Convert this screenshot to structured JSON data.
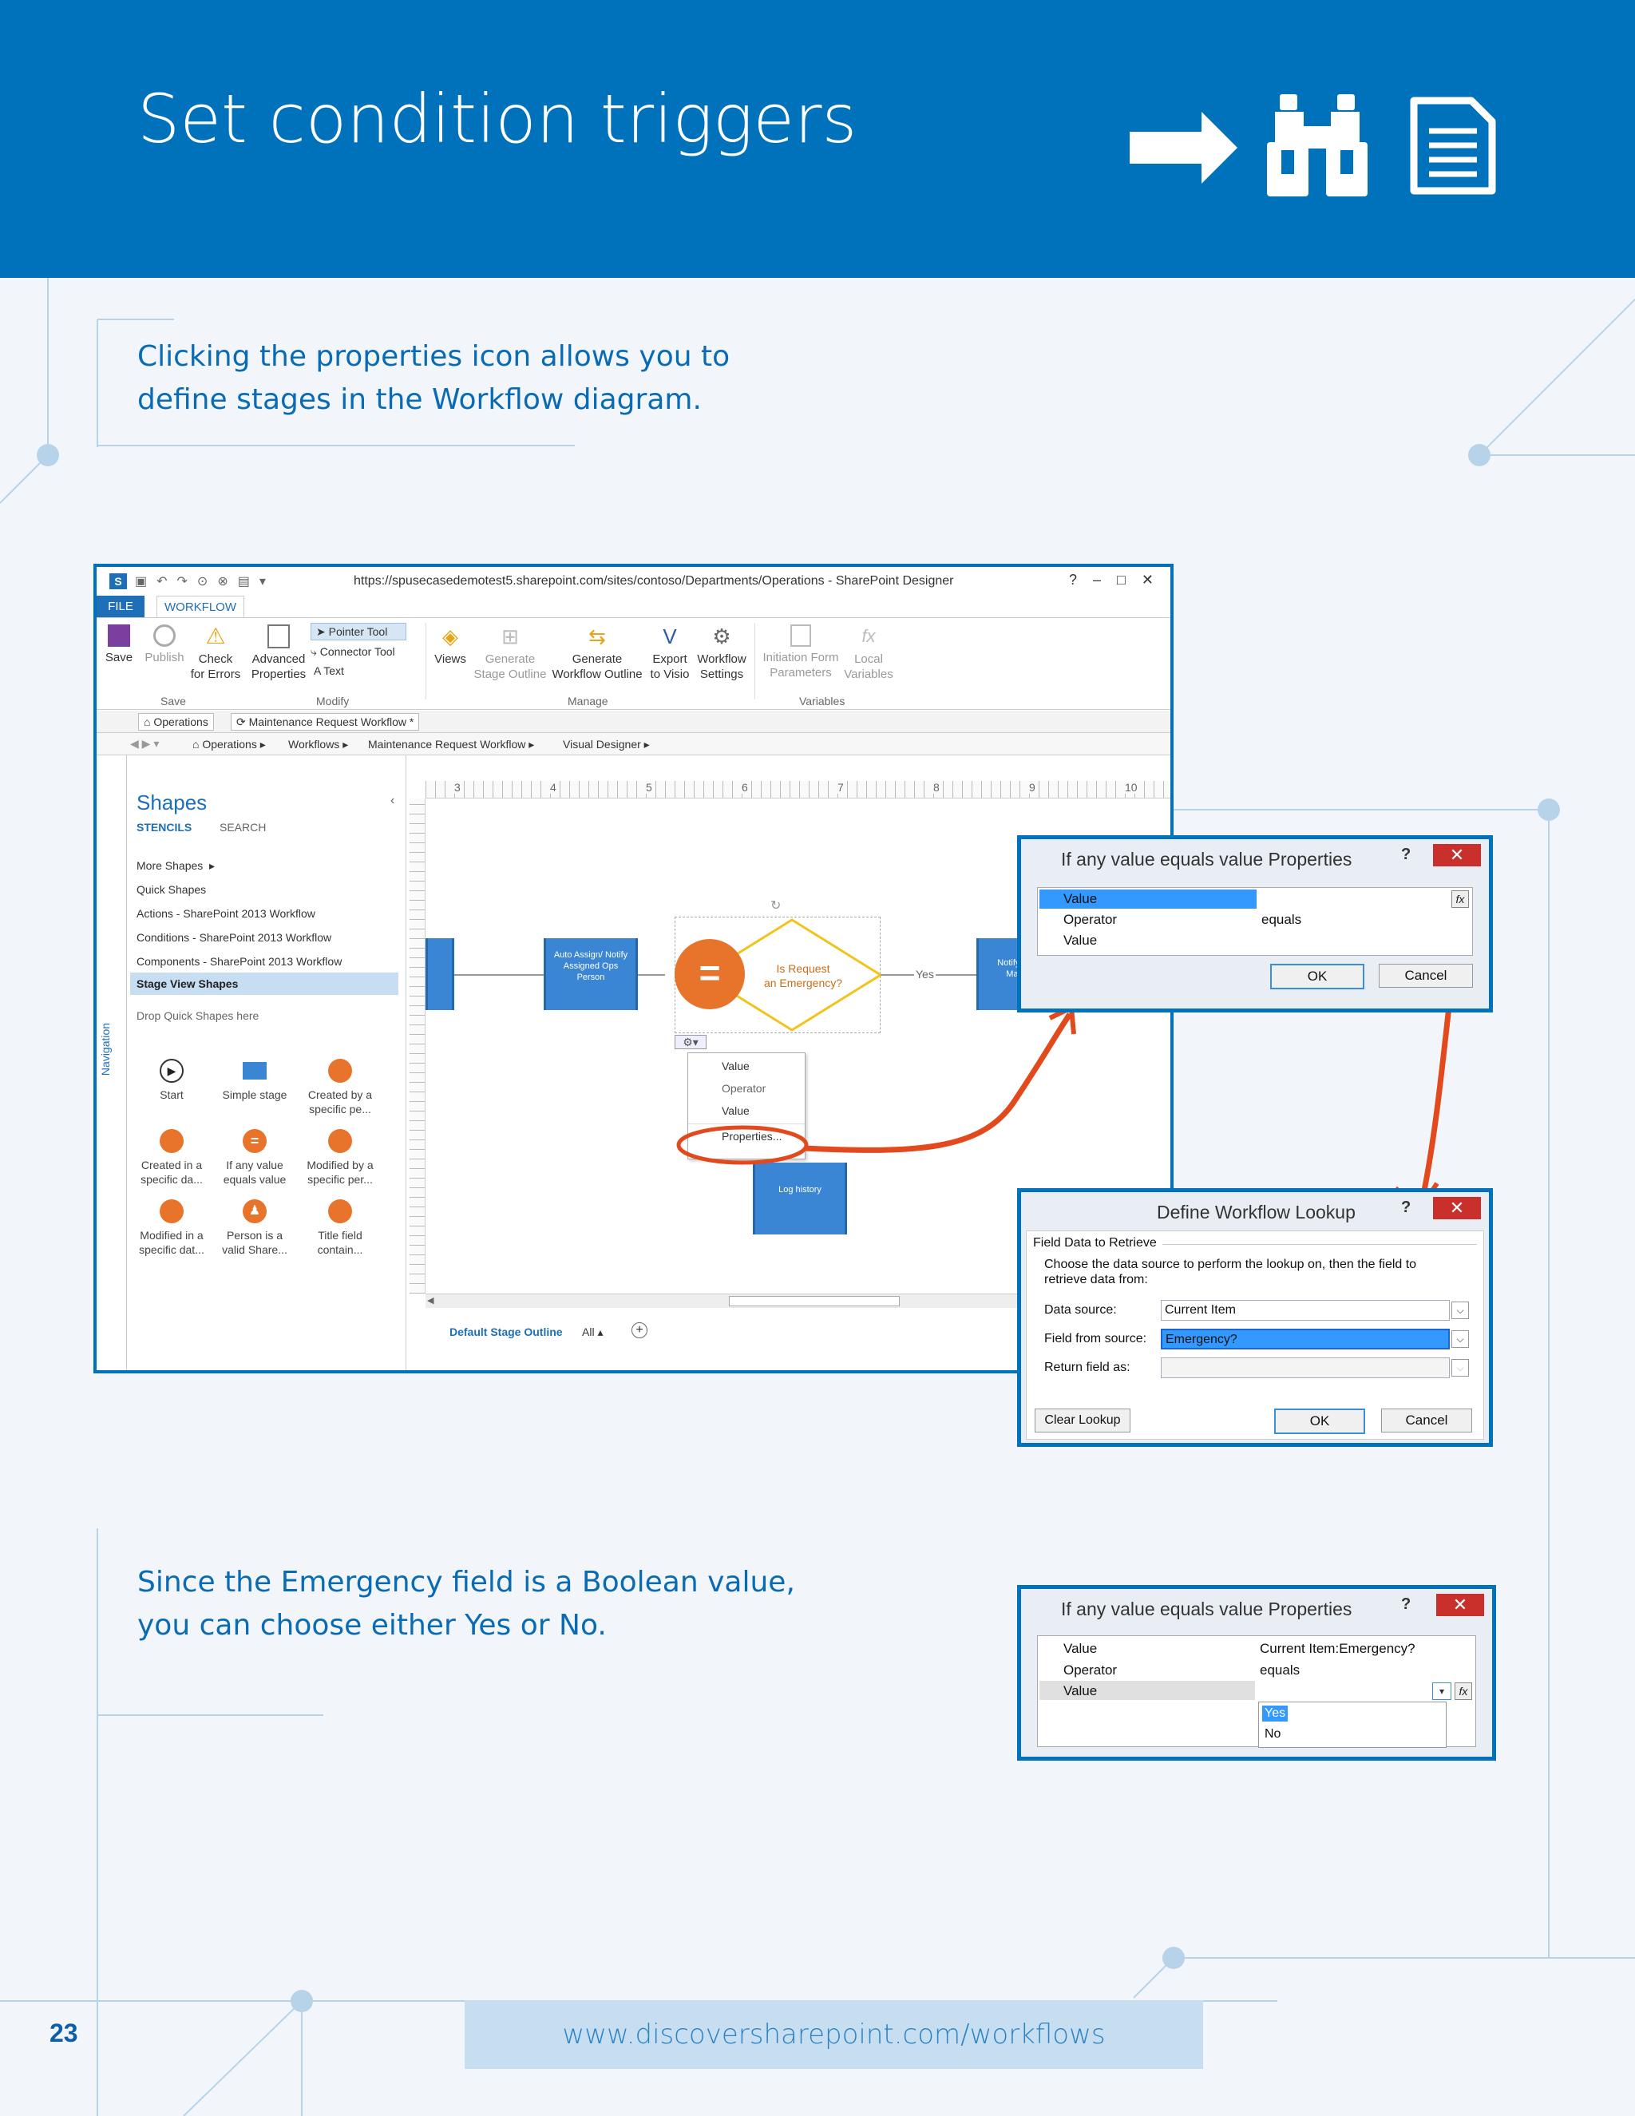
{
  "page": {
    "title": "Set condition triggers",
    "caption_1": "Clicking the properties icon allows you to define stages in the Workflow diagram.",
    "caption_2": "Since the Emergency field is a Boolean value, you can choose either Yes or No.",
    "footer_url": "www.discoversharepoint.com/workflows",
    "page_number": "23",
    "icons": [
      "arrow-right-icon",
      "binoculars-icon",
      "document-icon"
    ],
    "colors": {
      "header": "#0072bc",
      "accent": "#e8572a",
      "text_blue": "#0a6bb5"
    }
  },
  "spd": {
    "url": "https://spusecasedemotest5.sharepoint.com/sites/contoso/Departments/Operations - SharePoint Designer",
    "tabs": [
      "FILE",
      "WORKFLOW"
    ],
    "ribbon": {
      "save": "Save",
      "publish": "Publish",
      "check_1": "Check",
      "check_2": "for Errors",
      "adv_1": "Advanced",
      "adv_2": "Properties",
      "pointer": "Pointer Tool",
      "connector": "Connector Tool",
      "text": "Text",
      "views": "Views",
      "gen_stage_1": "Generate",
      "gen_stage_2": "Stage Outline",
      "gen_wf_1": "Generate",
      "gen_wf_2": "Workflow Outline",
      "export_1": "Export",
      "export_2": "to Visio",
      "wfset_1": "Workflow",
      "wfset_2": "Settings",
      "init_1": "Initiation Form",
      "init_2": "Parameters",
      "local_1": "Local",
      "local_2": "Variables",
      "group_save": "Save",
      "group_modify": "Modify",
      "group_manage": "Manage",
      "group_variables": "Variables"
    },
    "doc_tabs": [
      "Operations",
      "Maintenance Request Workflow *"
    ],
    "breadcrumb": [
      "Operations",
      "Workflows",
      "Maintenance Request Workflow",
      "Visual Designer"
    ],
    "shapes": {
      "title": "Shapes",
      "stencils": "STENCILS",
      "search": "SEARCH",
      "list": [
        "More Shapes",
        "Quick Shapes",
        "Actions - SharePoint 2013 Workflow",
        "Conditions - SharePoint 2013 Workflow",
        "Components - SharePoint 2013 Workflow",
        "Stage View Shapes"
      ],
      "drop": "Drop Quick Shapes here",
      "items": [
        {
          "l1": "Start",
          "l2": ""
        },
        {
          "l1": "Simple stage",
          "l2": ""
        },
        {
          "l1": "Created by a",
          "l2": "specific pe..."
        },
        {
          "l1": "Created in a",
          "l2": "specific da..."
        },
        {
          "l1": "If any value",
          "l2": "equals value"
        },
        {
          "l1": "Modified by a",
          "l2": "specific per..."
        },
        {
          "l1": "Modified in a",
          "l2": "specific dat..."
        },
        {
          "l1": "Person is a",
          "l2": "valid Share..."
        },
        {
          "l1": "Title field",
          "l2": "contain..."
        }
      ],
      "navigation": "Navigation"
    },
    "ruler": [
      "3",
      "4",
      "5",
      "6",
      "7",
      "8",
      "9",
      "10"
    ],
    "canvas": {
      "auto_assign": "Auto Assign/ Notify Assigned Ops Person",
      "decision_1": "Is Request",
      "decision_2": "an Emergency?",
      "yes": "Yes",
      "notify": "Notify Facility Manager",
      "log": "Log history",
      "menu": [
        "Value",
        "Operator",
        "Value",
        "Properties..."
      ]
    },
    "status": {
      "outline": "Default Stage Outline",
      "all": "All"
    }
  },
  "dialog1": {
    "title": "If any value equals value Properties",
    "rows": [
      {
        "name": "Value",
        "value": ""
      },
      {
        "name": "Operator",
        "value": "equals"
      },
      {
        "name": "Value",
        "value": ""
      }
    ],
    "ok": "OK",
    "cancel": "Cancel"
  },
  "lookup": {
    "title": "Define Workflow Lookup",
    "section": "Field Data to Retrieve",
    "instructions": "Choose the data source to perform the lookup on, then the field to retrieve data from:",
    "data_source_label": "Data source:",
    "data_source_value": "Current Item",
    "field_label": "Field from source:",
    "field_value": "Emergency?",
    "return_label": "Return field as:",
    "return_value": "",
    "clear": "Clear Lookup",
    "ok": "OK",
    "cancel": "Cancel"
  },
  "dialog2": {
    "title": "If any value equals value Properties",
    "rows": [
      {
        "name": "Value",
        "value": "Current Item:Emergency?"
      },
      {
        "name": "Operator",
        "value": "equals"
      },
      {
        "name": "Value",
        "value": ""
      }
    ],
    "options": [
      "Yes",
      "No"
    ]
  }
}
